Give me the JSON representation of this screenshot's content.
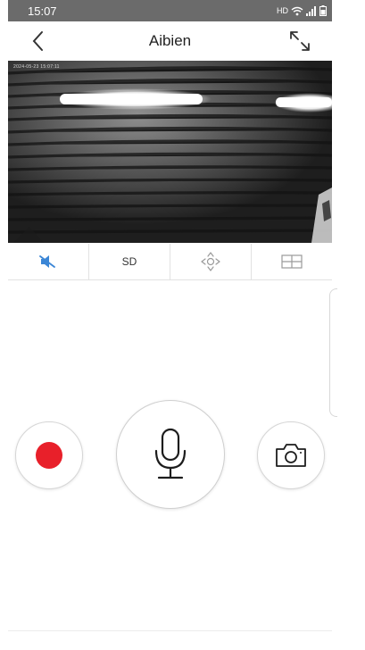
{
  "status_bar": {
    "time": "15:07",
    "network_badge": "HD",
    "icons": [
      "wifi-icon",
      "signal-icon",
      "battery-icon"
    ]
  },
  "header": {
    "title": "Aibien",
    "back_icon": "chevron-left-icon",
    "fullscreen_icon": "expand-arrows-icon"
  },
  "video": {
    "osd_text": "2024-05-23 15:07:11"
  },
  "controls": {
    "mute_icon": "speaker-muted-icon",
    "quality_label": "SD",
    "ptz_icon": "ptz-direction-icon",
    "layout_icon": "grid-layout-icon"
  },
  "actions": {
    "record_icon": "record-dot-icon",
    "talk_icon": "microphone-icon",
    "snapshot_icon": "camera-icon"
  },
  "colors": {
    "status_bar": "#6b6b6b",
    "accent_blue": "#3b86d6",
    "record_red": "#e8202a",
    "icon_gray": "#9a9a9a"
  }
}
